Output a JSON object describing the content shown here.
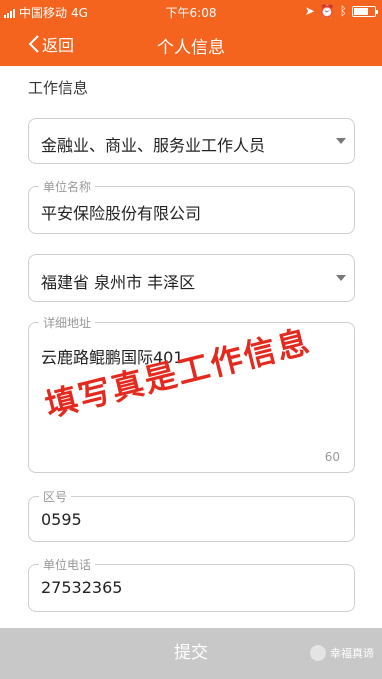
{
  "status_bar": {
    "carrier": "中国移动",
    "network": "4G",
    "time": "下午6:08"
  },
  "nav": {
    "back_label": "返回",
    "title": "个人信息"
  },
  "form": {
    "section_title": "工作信息",
    "occupation": {
      "value": "金融业、商业、服务业工作人员"
    },
    "company": {
      "label": "单位名称",
      "value": "平安保险股份有限公司"
    },
    "region": {
      "value": "福建省 泉州市 丰泽区"
    },
    "address": {
      "label": "详细地址",
      "value": "云鹿路鲲鹏国际401",
      "counter": "60"
    },
    "area_code": {
      "label": "区号",
      "value": "0595"
    },
    "phone": {
      "label": "单位电话",
      "value": "27532365"
    }
  },
  "overlay_text": "填写真是工作信息",
  "submit_label": "提交",
  "watermark": "幸福真谛",
  "colors": {
    "brand": "#f5641e",
    "annotation_red": "#e42a1f",
    "submit_disabled": "#c8c8c8"
  }
}
